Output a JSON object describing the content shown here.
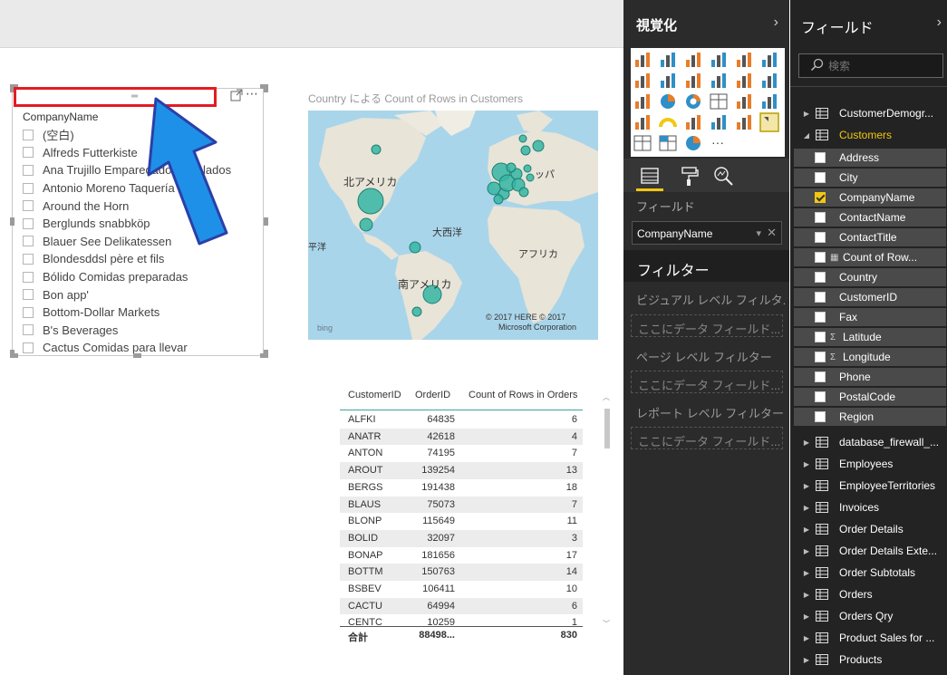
{
  "slicer": {
    "title": "CompanyName",
    "items": [
      "(空白)",
      "Alfreds Futterkiste",
      "Ana Trujillo Emparedados y helados",
      "Antonio Moreno Taquería",
      "Around the Horn",
      "Berglunds snabbköp",
      "Blauer See Delikatessen",
      "Blondesddsl père et fils",
      "Bólido Comidas preparadas",
      "Bon app'",
      "Bottom-Dollar Markets",
      "B's Beverages",
      "Cactus Comidas para llevar"
    ]
  },
  "map": {
    "title": "Country による Count of Rows in Customers",
    "labels": {
      "north_america": "北アメリカ",
      "south_america": "南アメリカ",
      "atlantic": "大西洋",
      "africa": "アフリカ",
      "europe": "ッパ",
      "pacific": "平洋"
    },
    "copyright_line1": "© 2017 HERE   © 2017",
    "copyright_line2": "Microsoft Corporation",
    "bing": "bing"
  },
  "table": {
    "headers": [
      "CustomerID",
      "OrderID",
      "Count of Rows in Orders"
    ],
    "rows": [
      [
        "ALFKI",
        "64835",
        "6"
      ],
      [
        "ANATR",
        "42618",
        "4"
      ],
      [
        "ANTON",
        "74195",
        "7"
      ],
      [
        "AROUT",
        "139254",
        "13"
      ],
      [
        "BERGS",
        "191438",
        "18"
      ],
      [
        "BLAUS",
        "75073",
        "7"
      ],
      [
        "BLONP",
        "115649",
        "11"
      ],
      [
        "BOLID",
        "32097",
        "3"
      ],
      [
        "BONAP",
        "181656",
        "17"
      ],
      [
        "BOTTM",
        "150763",
        "14"
      ],
      [
        "BSBEV",
        "106411",
        "10"
      ],
      [
        "CACTU",
        "64994",
        "6"
      ],
      [
        "CENTC",
        "10259",
        "1"
      ]
    ],
    "total": [
      "合計",
      "88498...",
      "830"
    ]
  },
  "viz_pane": {
    "title": "視覚化",
    "fields_label": "フィールド",
    "field_well_value": "CompanyName",
    "filters_title": "フィルター",
    "visual_filter_label": "ビジュアル レベル フィルタ...",
    "visual_filter_drop": "ここにデータ フィールド...",
    "page_filter_label": "ページ レベル フィルター",
    "page_filter_drop": "ここにデータ フィールド...",
    "report_filter_label": "レポート レベル フィルター",
    "report_filter_drop": "ここにデータ フィールド..."
  },
  "fields_pane": {
    "title": "フィールド",
    "search_placeholder": "検索",
    "tables_before": [
      "CustomerDemogr..."
    ],
    "open_table": "Customers",
    "columns": [
      {
        "name": "Address",
        "checked": false,
        "icon": ""
      },
      {
        "name": "City",
        "checked": false,
        "icon": ""
      },
      {
        "name": "CompanyName",
        "checked": true,
        "icon": ""
      },
      {
        "name": "ContactName",
        "checked": false,
        "icon": ""
      },
      {
        "name": "ContactTitle",
        "checked": false,
        "icon": ""
      },
      {
        "name": "Count of Row...",
        "checked": false,
        "icon": "calc"
      },
      {
        "name": "Country",
        "checked": false,
        "icon": ""
      },
      {
        "name": "CustomerID",
        "checked": false,
        "icon": ""
      },
      {
        "name": "Fax",
        "checked": false,
        "icon": ""
      },
      {
        "name": "Latitude",
        "checked": false,
        "icon": "sigma"
      },
      {
        "name": "Longitude",
        "checked": false,
        "icon": "sigma"
      },
      {
        "name": "Phone",
        "checked": false,
        "icon": ""
      },
      {
        "name": "PostalCode",
        "checked": false,
        "icon": ""
      },
      {
        "name": "Region",
        "checked": false,
        "icon": ""
      }
    ],
    "tables_after": [
      "database_firewall_...",
      "Employees",
      "EmployeeTerritories",
      "Invoices",
      "Order Details",
      "Order Details Exte...",
      "Order Subtotals",
      "Orders",
      "Orders Qry",
      "Product Sales for ...",
      "Products"
    ]
  },
  "colors": {
    "accent": "#f2c811",
    "highlight_red": "#e31b23",
    "arrow_blue": "#1e90e8",
    "map_bubble": "#35b6a4"
  }
}
